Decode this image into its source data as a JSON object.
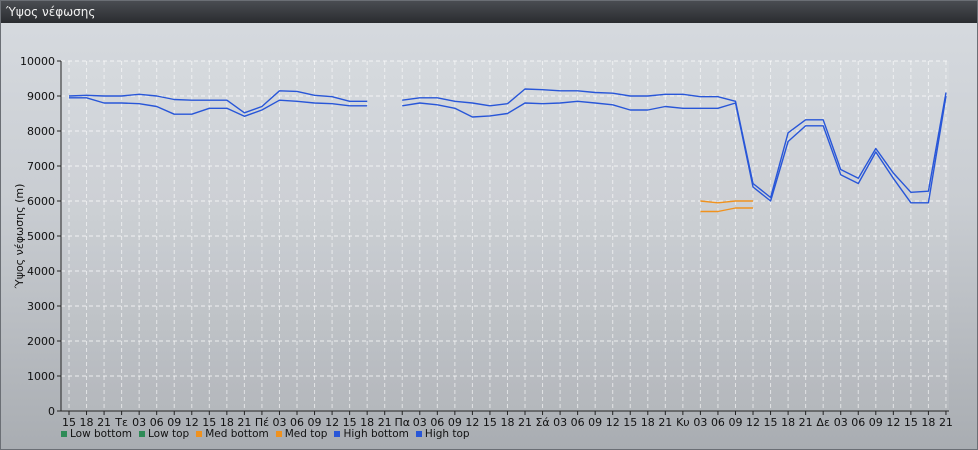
{
  "window": {
    "title": "Ύψος νέφωσης"
  },
  "colors": {
    "low": "#2e8b57",
    "med": "#f0921e",
    "high": "#2856d8",
    "grid": "#ffffff",
    "axis": "#222222"
  },
  "chart_data": {
    "type": "line",
    "title": "",
    "ylabel": "Ύψος νέφωσης (m)",
    "xlabel": "",
    "ylim": [
      0,
      10000
    ],
    "yticks": [
      0,
      1000,
      2000,
      3000,
      4000,
      5000,
      6000,
      7000,
      8000,
      9000,
      10000
    ],
    "grid": true,
    "legend_position": "bottom-left",
    "categories": [
      "15",
      "18",
      "21",
      "Τε",
      "03",
      "06",
      "09",
      "12",
      "15",
      "18",
      "21",
      "Πέ",
      "03",
      "06",
      "09",
      "12",
      "15",
      "18",
      "21",
      "Πα",
      "03",
      "06",
      "09",
      "12",
      "15",
      "18",
      "21",
      "Σά",
      "03",
      "06",
      "09",
      "12",
      "15",
      "18",
      "21",
      "Κυ",
      "03",
      "06",
      "09",
      "12",
      "15",
      "18",
      "21",
      "Δε",
      "03",
      "06",
      "09",
      "12",
      "15",
      "18",
      "21"
    ],
    "series": [
      {
        "name": "Low bottom",
        "color": "#2e8b57",
        "points": []
      },
      {
        "name": "Low top",
        "color": "#2e8b57",
        "points": []
      },
      {
        "name": "Med bottom",
        "color": "#f0921e",
        "points": [
          [
            36,
            5700
          ],
          [
            37,
            5700
          ],
          [
            38,
            5800
          ],
          [
            39,
            5800
          ]
        ]
      },
      {
        "name": "Med top",
        "color": "#f0921e",
        "points": [
          [
            36,
            6000
          ],
          [
            37,
            5950
          ],
          [
            38,
            6000
          ],
          [
            39,
            6000
          ]
        ]
      },
      {
        "name": "High bottom",
        "color": "#2856d8",
        "points": [
          [
            0,
            8950
          ],
          [
            1,
            8950
          ],
          [
            2,
            8800
          ],
          [
            3,
            8800
          ],
          [
            4,
            8780
          ],
          [
            5,
            8700
          ],
          [
            6,
            8480
          ],
          [
            7,
            8480
          ],
          [
            8,
            8650
          ],
          [
            9,
            8650
          ],
          [
            10,
            8420
          ],
          [
            11,
            8600
          ],
          [
            12,
            8880
          ],
          [
            13,
            8850
          ],
          [
            14,
            8800
          ],
          [
            15,
            8780
          ],
          [
            16,
            8720
          ],
          [
            17,
            8720
          ],
          [
            19,
            8720
          ],
          [
            20,
            8800
          ],
          [
            21,
            8750
          ],
          [
            22,
            8650
          ],
          [
            23,
            8400
          ],
          [
            24,
            8430
          ],
          [
            25,
            8500
          ],
          [
            26,
            8800
          ],
          [
            27,
            8780
          ],
          [
            28,
            8800
          ],
          [
            29,
            8850
          ],
          [
            30,
            8800
          ],
          [
            31,
            8750
          ],
          [
            32,
            8600
          ],
          [
            33,
            8600
          ],
          [
            34,
            8700
          ],
          [
            35,
            8650
          ],
          [
            36,
            8650
          ],
          [
            37,
            8650
          ],
          [
            38,
            8800
          ],
          [
            39,
            6400
          ],
          [
            40,
            6000
          ],
          [
            41,
            7700
          ],
          [
            42,
            8150
          ],
          [
            43,
            8150
          ],
          [
            44,
            6750
          ],
          [
            45,
            6500
          ],
          [
            46,
            7400
          ],
          [
            47,
            6650
          ],
          [
            48,
            5950
          ],
          [
            49,
            5950
          ],
          [
            50,
            9000
          ]
        ]
      },
      {
        "name": "High top",
        "color": "#2856d8",
        "points": [
          [
            0,
            9000
          ],
          [
            1,
            9020
          ],
          [
            2,
            9000
          ],
          [
            3,
            9000
          ],
          [
            4,
            9050
          ],
          [
            5,
            9000
          ],
          [
            6,
            8900
          ],
          [
            7,
            8880
          ],
          [
            8,
            8880
          ],
          [
            9,
            8880
          ],
          [
            10,
            8520
          ],
          [
            11,
            8700
          ],
          [
            12,
            9150
          ],
          [
            13,
            9130
          ],
          [
            14,
            9020
          ],
          [
            15,
            8980
          ],
          [
            16,
            8850
          ],
          [
            17,
            8850
          ],
          [
            19,
            8880
          ],
          [
            20,
            8950
          ],
          [
            21,
            8950
          ],
          [
            22,
            8850
          ],
          [
            23,
            8800
          ],
          [
            24,
            8720
          ],
          [
            25,
            8780
          ],
          [
            26,
            9200
          ],
          [
            27,
            9180
          ],
          [
            28,
            9150
          ],
          [
            29,
            9150
          ],
          [
            30,
            9100
          ],
          [
            31,
            9080
          ],
          [
            32,
            9000
          ],
          [
            33,
            9000
          ],
          [
            34,
            9050
          ],
          [
            35,
            9050
          ],
          [
            36,
            8980
          ],
          [
            37,
            8980
          ],
          [
            38,
            8850
          ],
          [
            39,
            6500
          ],
          [
            40,
            6100
          ],
          [
            41,
            7950
          ],
          [
            42,
            8320
          ],
          [
            43,
            8320
          ],
          [
            44,
            6900
          ],
          [
            45,
            6650
          ],
          [
            46,
            7500
          ],
          [
            47,
            6800
          ],
          [
            48,
            6250
          ],
          [
            49,
            6280
          ],
          [
            50,
            9100
          ]
        ]
      }
    ]
  }
}
